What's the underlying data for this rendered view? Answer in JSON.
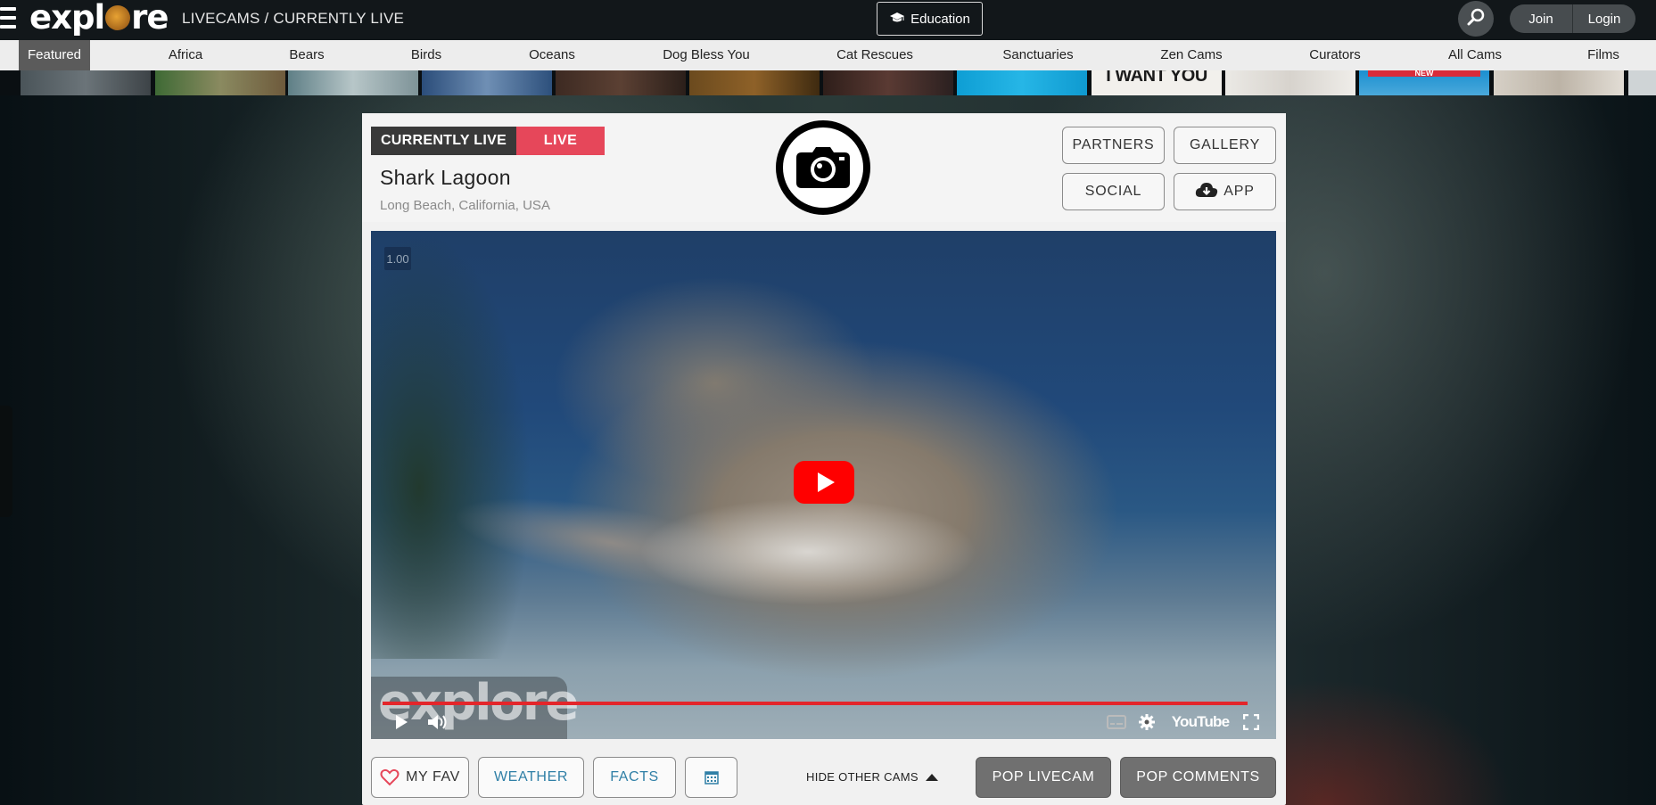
{
  "header": {
    "logo_text_pre": "expl",
    "logo_text_post": "re",
    "breadcrumb": "LIVECAMS / CURRENTLY LIVE",
    "education_label": "Education",
    "join_label": "Join",
    "login_label": "Login"
  },
  "categories": [
    {
      "label": "Featured",
      "active": true
    },
    {
      "label": "Africa"
    },
    {
      "label": "Bears"
    },
    {
      "label": "Birds"
    },
    {
      "label": "Oceans"
    },
    {
      "label": "Dog Bless You"
    },
    {
      "label": "Cat Rescues"
    },
    {
      "label": "Sanctuaries"
    },
    {
      "label": "Zen Cams"
    },
    {
      "label": "Curators"
    },
    {
      "label": "All Cams"
    },
    {
      "label": "Films"
    }
  ],
  "thumbnails": {
    "text_want": "I WANT YOU",
    "text_new": "NEW"
  },
  "cam": {
    "badge_label": "CURRENTLY LIVE",
    "live_label": "LIVE",
    "title": "Shark Lagoon",
    "location": "Long Beach, California, USA",
    "partners_label": "PARTNERS",
    "gallery_label": "GALLERY",
    "social_label": "SOCIAL",
    "app_label": "APP"
  },
  "player": {
    "speed": "1.00",
    "watermark": "explore",
    "youtube_label": "YouTube",
    "progress_fraction": 0.96
  },
  "actions": {
    "fav_label": "MY FAV",
    "weather_label": "WEATHER",
    "facts_label": "FACTS",
    "hide_cams_label": "HIDE OTHER CAMS",
    "pop_livecam_label": "POP LIVECAM",
    "pop_comments_label": "POP COMMENTS"
  },
  "colors": {
    "live_red": "#e6475a",
    "link_blue": "#2f7fa6",
    "topbar": "#12171a"
  }
}
